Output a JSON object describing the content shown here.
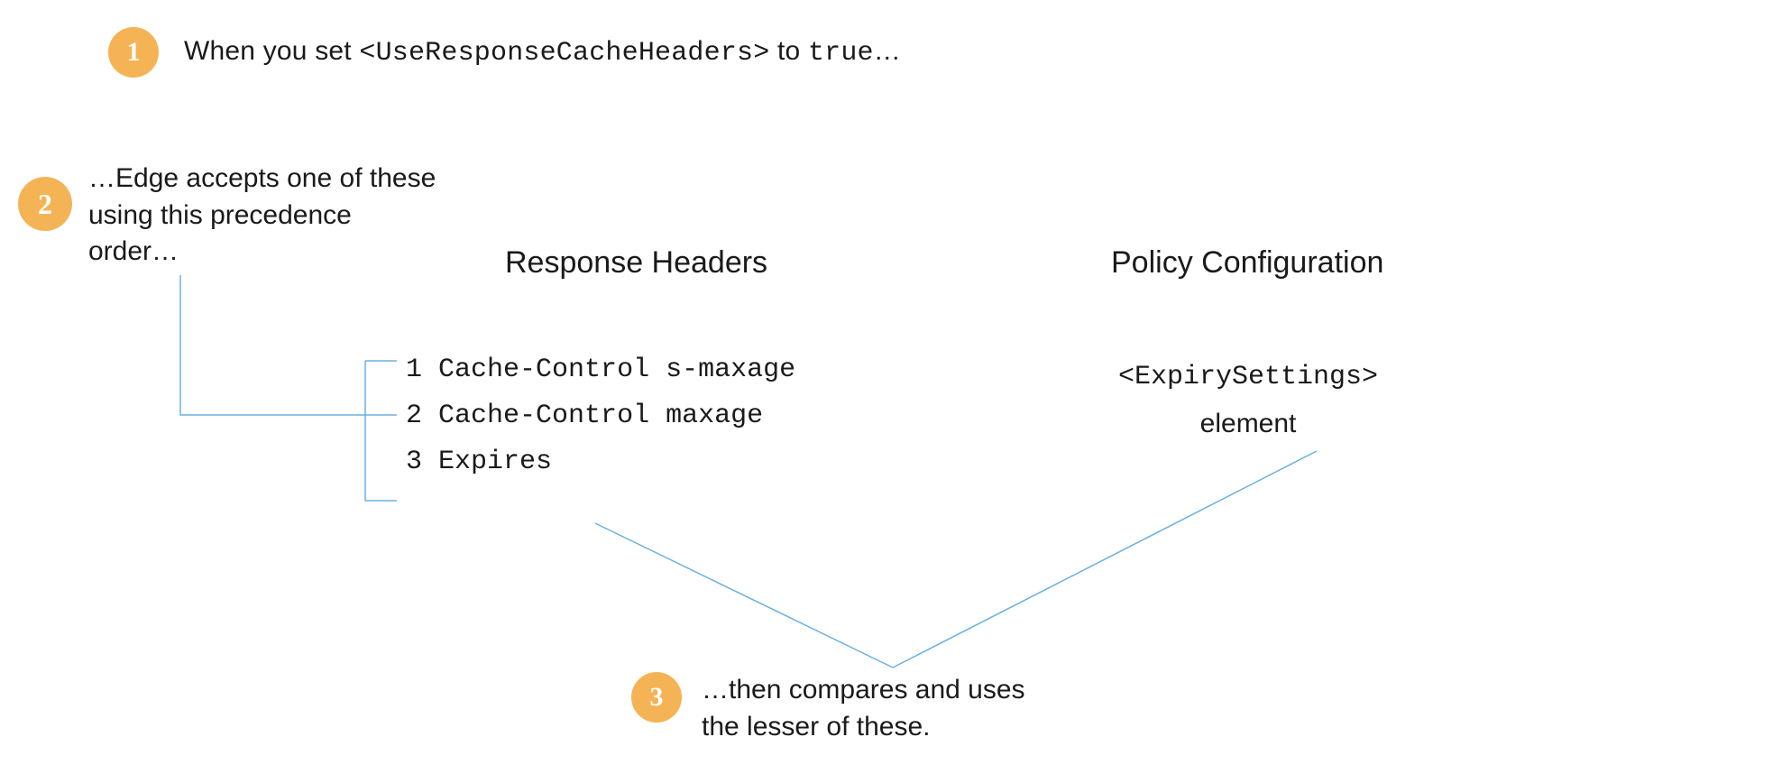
{
  "step1": {
    "number": "1",
    "prefix": "When you set ",
    "tag": "<UseResponseCacheHeaders>",
    "mid": " to ",
    "value": "true",
    "suffix": "…"
  },
  "step2": {
    "number": "2",
    "text": "…Edge accepts one of these using this precedence order…"
  },
  "responseHeaders": {
    "title": "Response Headers",
    "items": [
      {
        "num": "1",
        "label": "Cache-Control s-maxage"
      },
      {
        "num": "2",
        "label": "Cache-Control maxage"
      },
      {
        "num": "3",
        "label": "Expires"
      }
    ]
  },
  "policy": {
    "title": "Policy Configuration",
    "tag": "<ExpirySettings>",
    "label": "element"
  },
  "step3": {
    "number": "3",
    "text": "…then compares and uses the lesser of these."
  }
}
